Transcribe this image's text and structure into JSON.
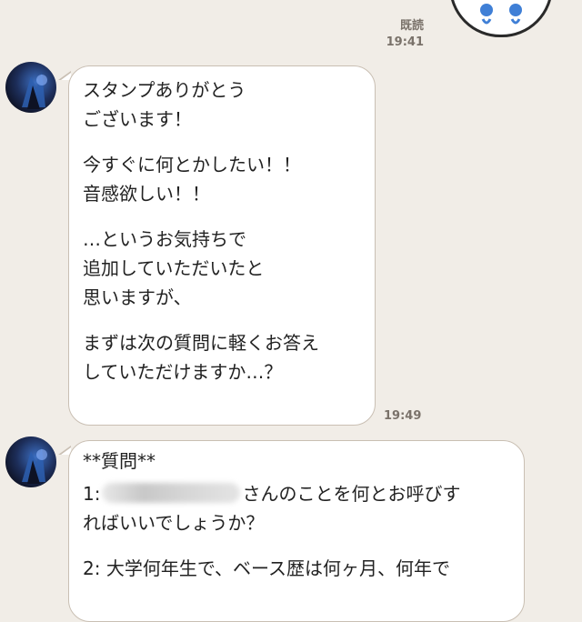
{
  "chat": {
    "sent_meta": {
      "read_label": "既読",
      "time": "19:41"
    },
    "message1": {
      "paragraphs": [
        "スタンプありがとう\nございます！",
        "今すぐに何とかしたい！！\n音感欲しい！！",
        "…というお気持ちで\n追加していただいたと\n思いますが、",
        "まずは次の質問に軽くお答え\nしていただけますか…？"
      ],
      "time": "19:49"
    },
    "message2": {
      "heading": "**質問**",
      "q1_prefix": "1:",
      "q1_rest": "さんのことを何とお呼びす\nればいいでしょうか？",
      "q2": "2: 大学何年生で、ベース歴は何ヶ月、何年で"
    }
  },
  "colors": {
    "background": "#f1ede7",
    "bubble": "#ffffff",
    "bubble_border": "#c9bfb3",
    "meta_text": "#7a726a"
  },
  "icons": [
    "sticker-icon",
    "avatar"
  ]
}
